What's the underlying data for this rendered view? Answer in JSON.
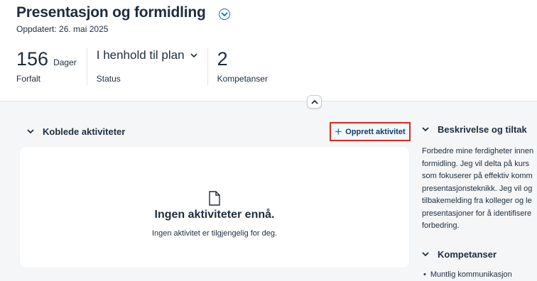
{
  "header": {
    "title": "Presentasjon og formidling",
    "updated": "Oppdatert: 26. mai 2025",
    "kpis": {
      "due_value": "156",
      "due_unit": "Dager",
      "due_label": "Forfalt",
      "status_value": "I henhold til plan",
      "status_label": "Status",
      "skills_value": "2",
      "skills_label": "Kompetanser"
    }
  },
  "linked_activities": {
    "heading": "Koblede aktiviteter",
    "create_label": "Opprett aktivitet",
    "empty_title": "Ingen aktiviteter ennå.",
    "empty_subtitle": "Ingen aktivitet er tilgjengelig for deg."
  },
  "description": {
    "heading": "Beskrivelse og tiltak",
    "lines": [
      "Forbedre mine ferdigheter innen",
      "formidling. Jeg vil delta på kurs",
      "som fokuserer på effektiv komm",
      "presentasjonsteknikk. Jeg vil og",
      "tilbakemelding fra kolleger og le",
      "presentasjoner for å identifisere",
      "forbedring."
    ]
  },
  "competencies": {
    "heading": "Kompetanser",
    "items": [
      "Muntlig kommunikasjon"
    ]
  },
  "colors": {
    "accent": "#0a6ed1",
    "highlight_border": "#e1251b",
    "text": "#1d2d3e",
    "background": "#f5f6f7"
  }
}
